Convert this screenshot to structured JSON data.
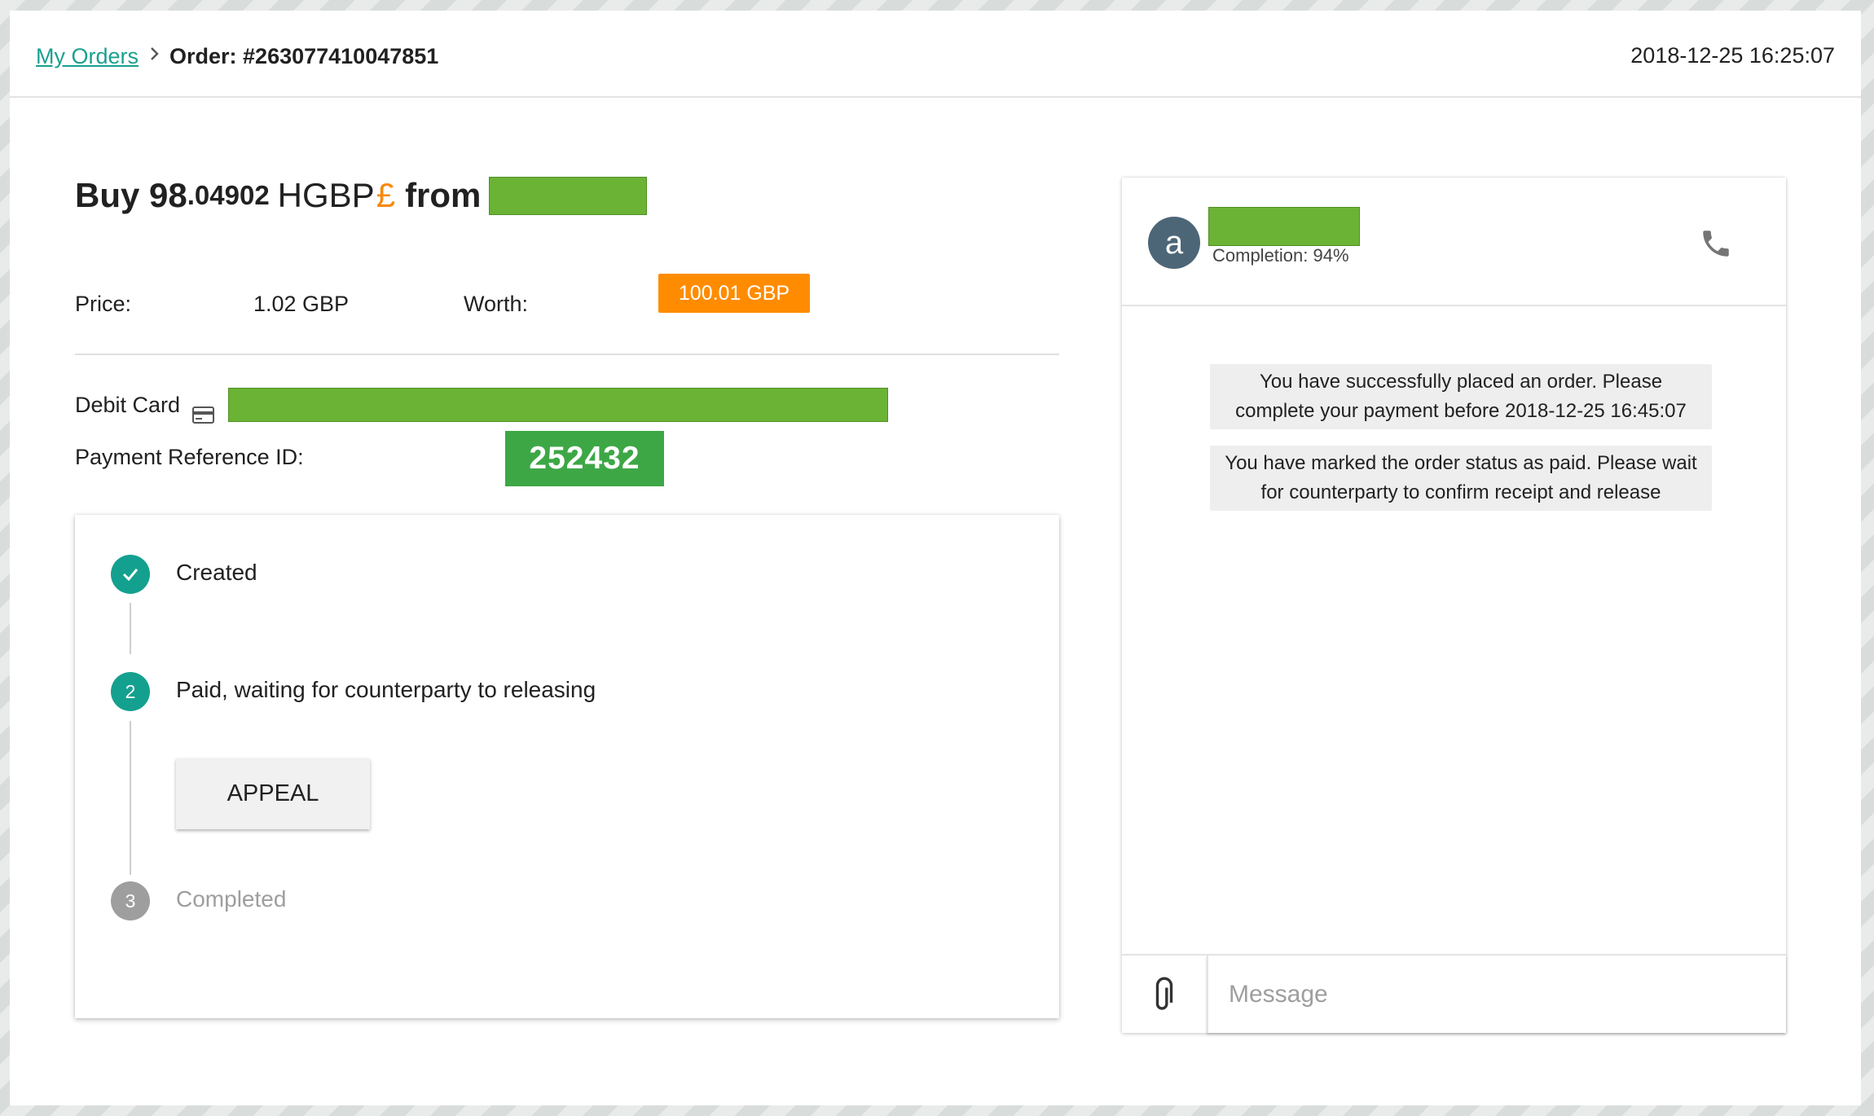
{
  "header": {
    "breadcrumb_link": "My Orders",
    "breadcrumb_current": "Order: #263077410047851",
    "timestamp": "2018-12-25 16:25:07"
  },
  "order": {
    "title_buy": "Buy 98",
    "title_amount_decimals": ".04902",
    "title_currency": "HGBP",
    "title_currency_symbol": "£",
    "title_from": "from",
    "price_label": "Price:",
    "price_value": "1.02 GBP",
    "worth_label": "Worth:",
    "worth_value": "100.01 GBP",
    "payment_method_label": "Debit Card",
    "reference_label": "Payment Reference ID:",
    "reference_value": "252432"
  },
  "steps": [
    {
      "number": "1",
      "label": "Created",
      "state": "done"
    },
    {
      "number": "2",
      "label": "Paid, waiting for counterparty to releasing",
      "state": "active"
    },
    {
      "number": "3",
      "label": "Completed",
      "state": "pending"
    }
  ],
  "appeal_label": "APPEAL",
  "chat": {
    "avatar_letter": "a",
    "completion": "Completion: 94%",
    "messages": [
      "You have successfully placed an order. Please complete your payment before 2018-12-25 16:45:07",
      "You have marked the order status as paid. Please wait for counterparty to confirm receipt and release"
    ],
    "input_placeholder": "Message"
  },
  "icons": {
    "breadcrumb_separator": "chevron-right-icon",
    "payment": "credit-card-icon",
    "step_done": "check-icon",
    "call": "phone-icon",
    "attach": "paperclip-icon"
  },
  "colors": {
    "accent_teal": "#19a08f",
    "worth_orange": "#ff8c00",
    "reference_green": "#3da746",
    "step_pending_gray": "#9e9e9e",
    "avatar_slate": "#4d6677"
  }
}
